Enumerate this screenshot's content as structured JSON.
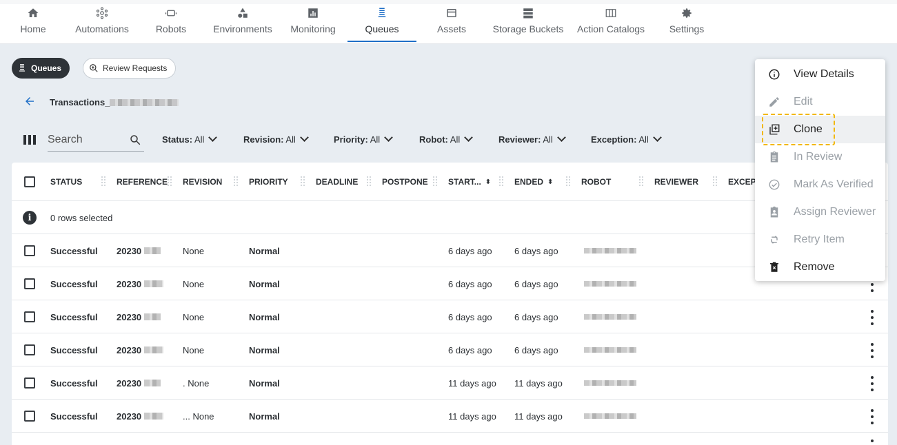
{
  "nav": [
    {
      "label": "Home",
      "icon": "home-icon"
    },
    {
      "label": "Automations",
      "icon": "automations-icon"
    },
    {
      "label": "Robots",
      "icon": "robot-icon"
    },
    {
      "label": "Environments",
      "icon": "environments-icon"
    },
    {
      "label": "Monitoring",
      "icon": "monitoring-icon"
    },
    {
      "label": "Queues",
      "icon": "queues-icon",
      "active": true
    },
    {
      "label": "Assets",
      "icon": "assets-icon"
    },
    {
      "label": "Storage Buckets",
      "icon": "storage-icon"
    },
    {
      "label": "Action Catalogs",
      "icon": "catalog-icon"
    },
    {
      "label": "Settings",
      "icon": "gear-icon"
    }
  ],
  "chips": {
    "queues": "Queues",
    "review": "Review Requests"
  },
  "breadcrumb": {
    "label": "Transactions_"
  },
  "search": {
    "placeholder": "Search"
  },
  "filters": [
    {
      "key": "Status:",
      "value": "All"
    },
    {
      "key": "Revision:",
      "value": "All"
    },
    {
      "key": "Priority:",
      "value": "All"
    },
    {
      "key": "Robot:",
      "value": "All"
    },
    {
      "key": "Reviewer:",
      "value": "All"
    },
    {
      "key": "Exception:",
      "value": "All"
    }
  ],
  "columns": [
    "STATUS",
    "REFERENCE",
    "REVISION",
    "PRIORITY",
    "DEADLINE",
    "POSTPONE",
    "START...",
    "ENDED",
    "ROBOT",
    "REVIEWER",
    "EXCEPT"
  ],
  "selection": {
    "text": "0 rows selected"
  },
  "rows": [
    {
      "status": "Successful",
      "reference": "20230",
      "revision": "None",
      "priority": "Normal",
      "started": "6 days ago",
      "ended": "6 days ago"
    },
    {
      "status": "Successful",
      "reference": "20230",
      "revision": "None",
      "priority": "Normal",
      "started": "6 days ago",
      "ended": "6 days ago"
    },
    {
      "status": "Successful",
      "reference": "20230",
      "revision": "None",
      "priority": "Normal",
      "started": "6 days ago",
      "ended": "6 days ago"
    },
    {
      "status": "Successful",
      "reference": "20230",
      "revision": "None",
      "priority": "Normal",
      "started": "6 days ago",
      "ended": "6 days ago"
    },
    {
      "status": "Successful",
      "reference": "20230",
      "revision": ". None",
      "priority": "Normal",
      "started": "11 days ago",
      "ended": "11 days ago"
    },
    {
      "status": "Successful",
      "reference": "20230",
      "revision": "... None",
      "priority": "Normal",
      "started": "11 days ago",
      "ended": "11 days ago"
    }
  ],
  "menu": [
    {
      "label": "View Details",
      "icon": "info-icon",
      "disabled": false
    },
    {
      "label": "Edit",
      "icon": "pencil-icon",
      "disabled": true
    },
    {
      "label": "Clone",
      "icon": "clone-icon",
      "disabled": false,
      "highlighted": true
    },
    {
      "label": "In Review",
      "icon": "clipboard-icon",
      "disabled": true
    },
    {
      "label": "Mark As Verified",
      "icon": "check-circle-icon",
      "disabled": true
    },
    {
      "label": "Assign Reviewer",
      "icon": "assign-reviewer-icon",
      "disabled": true
    },
    {
      "label": "Retry Item",
      "icon": "retry-icon",
      "disabled": true
    },
    {
      "label": "Remove",
      "icon": "trash-icon",
      "disabled": false
    }
  ],
  "colors": {
    "accent": "#1f6fc7",
    "focus": "#f2b705",
    "dark_chip": "#2e3338"
  }
}
